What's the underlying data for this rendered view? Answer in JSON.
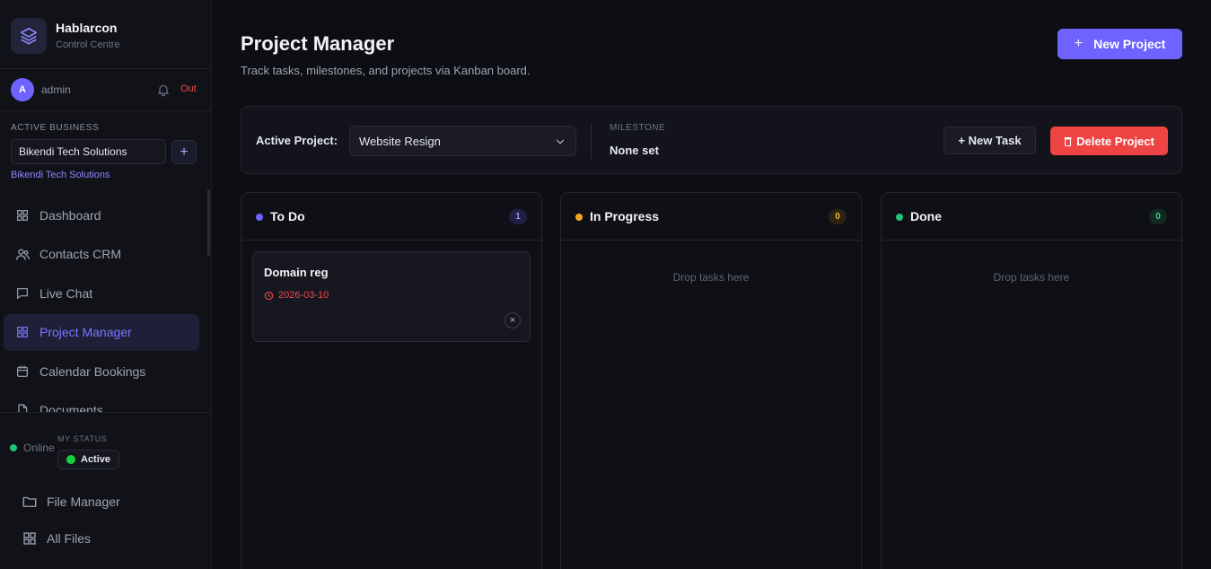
{
  "brand": {
    "name": "Hablarcon",
    "subtitle": "Control Centre"
  },
  "user": {
    "initial": "A",
    "name": "admin",
    "logout_label": "Out"
  },
  "business": {
    "section_label": "ACTIVE BUSINESS",
    "selected": "Bikendi Tech Solutions",
    "add_label": "+",
    "link_text": "Bikendi Tech Solutions"
  },
  "sidebar": {
    "items": [
      {
        "label": "Dashboard",
        "icon": "grid-icon"
      },
      {
        "label": "Contacts CRM",
        "icon": "users-icon"
      },
      {
        "label": "Live Chat",
        "icon": "chat-icon"
      },
      {
        "label": "Project Manager",
        "icon": "grid-icon",
        "active": true
      },
      {
        "label": "Calendar Bookings",
        "icon": "calendar-icon"
      },
      {
        "label": "Documents",
        "icon": "document-icon"
      }
    ],
    "bottom_items": [
      {
        "label": "File Manager",
        "icon": "folder-icon"
      },
      {
        "label": "All Files",
        "icon": "grid-icon"
      }
    ]
  },
  "status": {
    "online_label": "Online",
    "my_status_label": "MY STATUS",
    "my_status_value": "Active"
  },
  "header": {
    "title": "Project Manager",
    "subtitle": "Track tasks, milestones, and projects via Kanban board.",
    "new_project_label": "New Project",
    "new_project_plus": "+"
  },
  "toolbar": {
    "active_project_label": "Active Project:",
    "active_project_value": "Website Resign",
    "milestone_label": "MILESTONE",
    "milestone_value": "None set",
    "new_task_label": "+ New Task",
    "delete_project_label": "Delete Project"
  },
  "columns": [
    {
      "title": "To Do",
      "count": "1",
      "dot_color": "#6e63ff",
      "badge_bg": "#1f2140",
      "badge_color": "#9b96ff"
    },
    {
      "title": "In Progress",
      "count": "0",
      "dot_color": "#f5a524",
      "badge_bg": "#2a2313",
      "badge_color": "#f5b93a",
      "drop_hint": "Drop tasks here"
    },
    {
      "title": "Done",
      "count": "0",
      "dot_color": "#22c27a",
      "badge_bg": "#132a20",
      "badge_color": "#3ad08a",
      "drop_hint": "Drop tasks here"
    }
  ],
  "tasks": [
    {
      "title": "Domain reg",
      "due_date": "2026-03-10",
      "close_label": "×"
    }
  ],
  "colors": {
    "accent": "#6e63ff",
    "danger": "#ef4444",
    "background": "#0d0e13"
  }
}
